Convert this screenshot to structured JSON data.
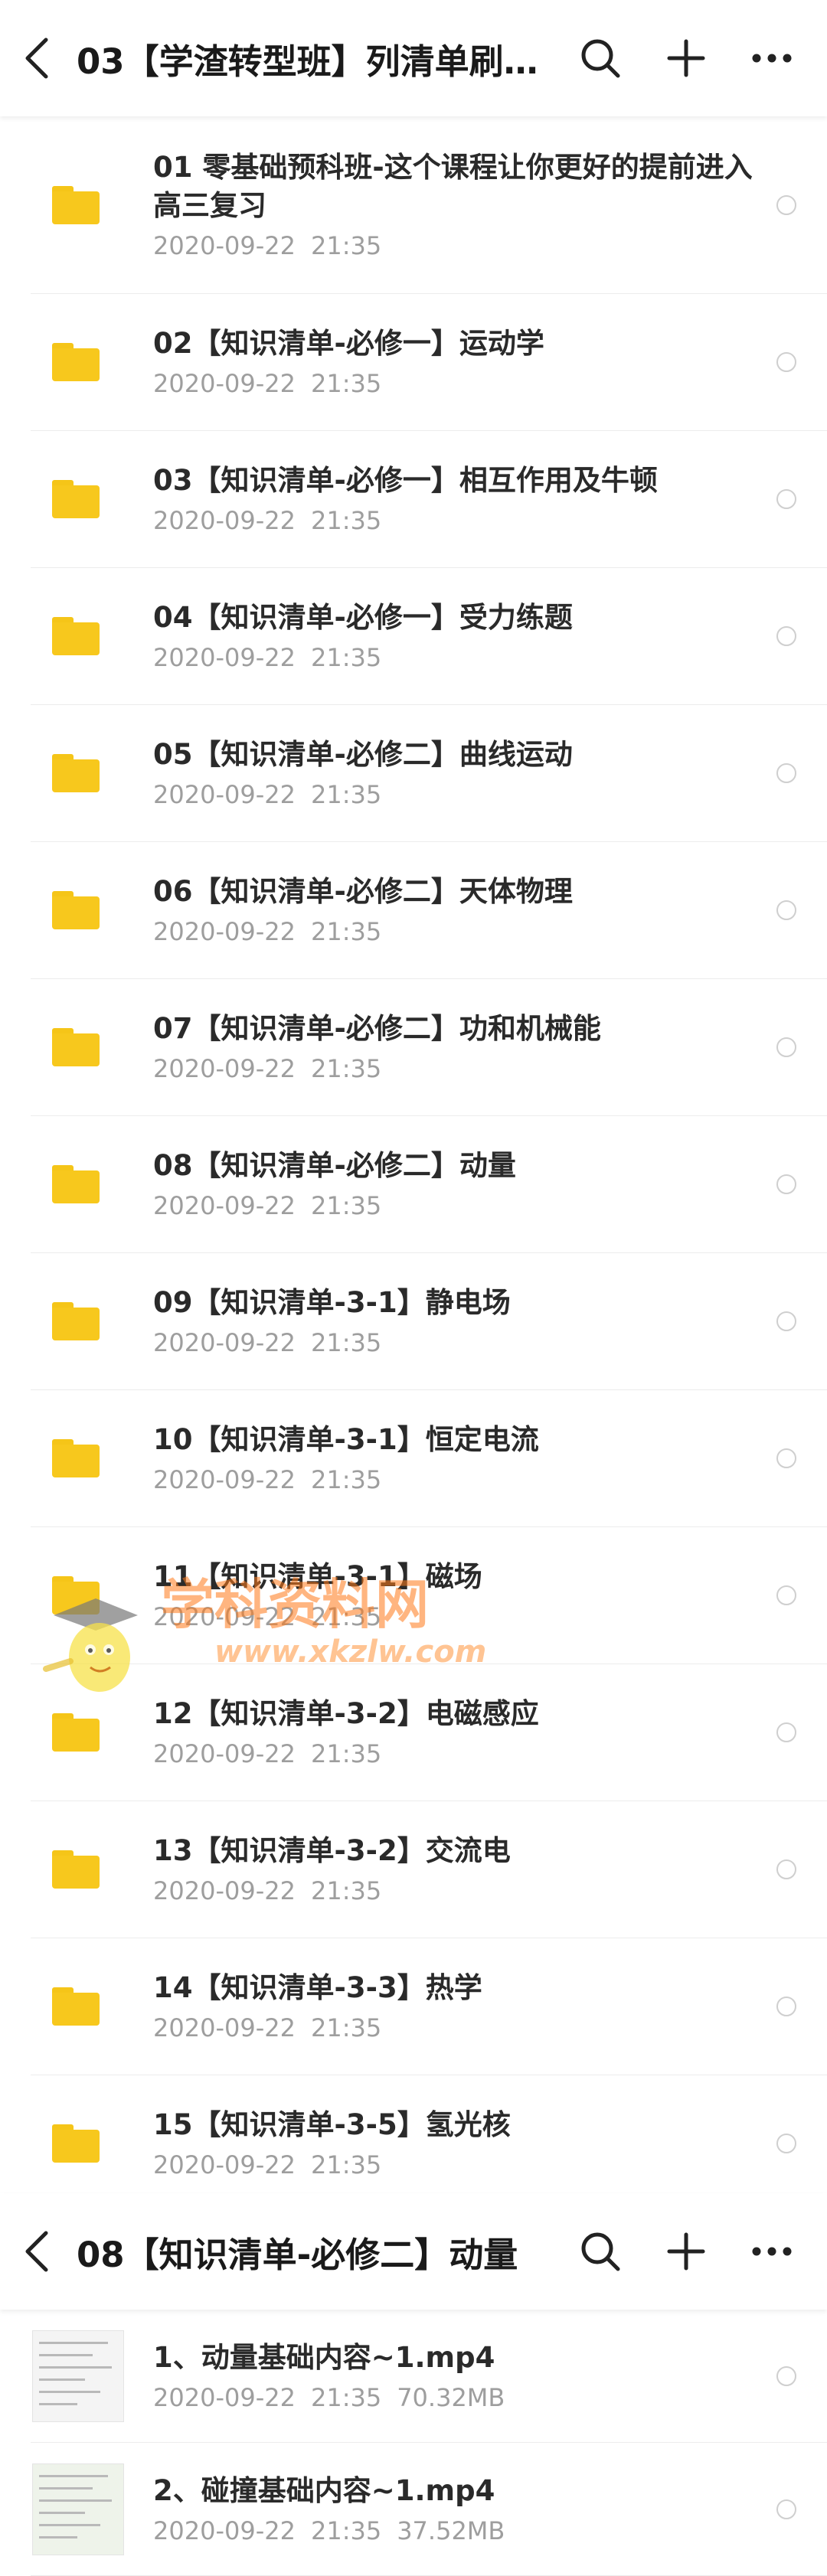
{
  "header": {
    "title": "03【学渣转型班】列清单刷...",
    "icons": [
      "back-arrow-icon",
      "search-icon",
      "plus-icon",
      "more-icon"
    ]
  },
  "folders": [
    {
      "name": "01 零基础预科班-这个课程让你更好的提前进入高三复习",
      "date": "2020-09-22",
      "time": "21:35"
    },
    {
      "name": "02【知识清单-必修一】运动学",
      "date": "2020-09-22",
      "time": "21:35"
    },
    {
      "name": "03【知识清单-必修一】相互作用及牛顿",
      "date": "2020-09-22",
      "time": "21:35"
    },
    {
      "name": "04【知识清单-必修一】受力练题",
      "date": "2020-09-22",
      "time": "21:35"
    },
    {
      "name": "05【知识清单-必修二】曲线运动",
      "date": "2020-09-22",
      "time": "21:35"
    },
    {
      "name": "06【知识清单-必修二】天体物理",
      "date": "2020-09-22",
      "time": "21:35"
    },
    {
      "name": "07【知识清单-必修二】功和机械能",
      "date": "2020-09-22",
      "time": "21:35"
    },
    {
      "name": "08【知识清单-必修二】动量",
      "date": "2020-09-22",
      "time": "21:35"
    },
    {
      "name": "09【知识清单-3-1】静电场",
      "date": "2020-09-22",
      "time": "21:35"
    },
    {
      "name": "10【知识清单-3-1】恒定电流",
      "date": "2020-09-22",
      "time": "21:35"
    },
    {
      "name": "11【知识清单-3-1】磁场",
      "date": "2020-09-22",
      "time": "21:35"
    },
    {
      "name": "12【知识清单-3-2】电磁感应",
      "date": "2020-09-22",
      "time": "21:35"
    },
    {
      "name": "13【知识清单-3-2】交流电",
      "date": "2020-09-22",
      "time": "21:35"
    },
    {
      "name": "14【知识清单-3-3】热学",
      "date": "2020-09-22",
      "time": "21:35"
    },
    {
      "name": "15【知识清单-3-5】氢光核",
      "date": "2020-09-22",
      "time": "21:35"
    }
  ],
  "header2": {
    "title": "08【知识清单-必修二】动量"
  },
  "files": [
    {
      "name": "1、动量基础内容~1.mp4",
      "date": "2020-09-22",
      "time": "21:35",
      "size": "70.32MB"
    },
    {
      "name": "2、碰撞基础内容~1.mp4",
      "date": "2020-09-22",
      "time": "21:35",
      "size": "37.52MB"
    }
  ],
  "watermark": {
    "text": "学科资料网",
    "url": "www.xkzlw.com"
  },
  "colors": {
    "folder": "#f7c81d",
    "watermark": "#ff7a1a"
  }
}
